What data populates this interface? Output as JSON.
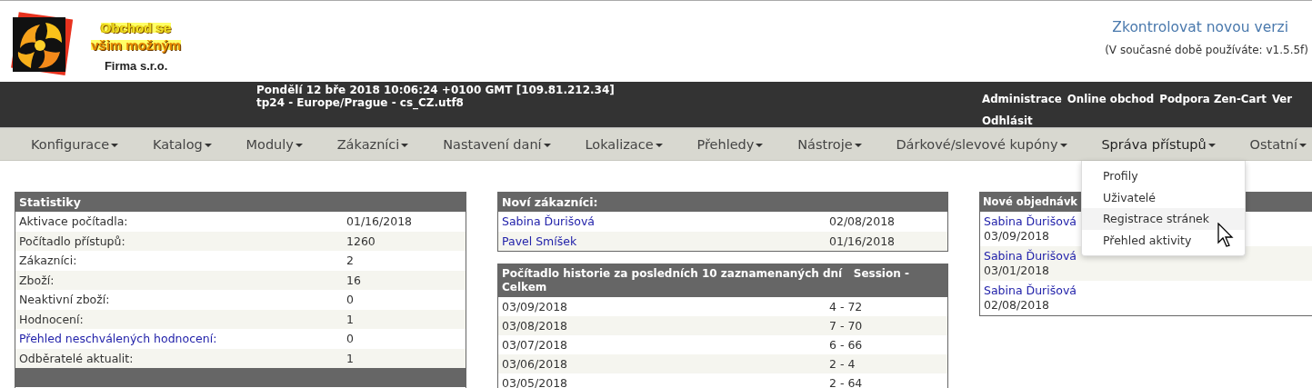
{
  "header": {
    "logo_lines": [
      "Obchod se",
      "všim možným"
    ],
    "company": "Firma s.r.o.",
    "update_link": "Zkontrolovat novou verzi",
    "version_note": "(V současné době používáte: v1.5.5f)"
  },
  "top_bar": {
    "info_lines": [
      "Pondělí 12 bře 2018 10:06:24 +0100 GMT [109.81.212.34]",
      "tp24 - Europe/Prague - cs_CZ.utf8"
    ],
    "links_row_1": [
      "Administrace",
      "Online obchod",
      "Podpora Zen-Cart",
      "Ver"
    ],
    "links_row_2": [
      "Odhlásit"
    ]
  },
  "nav": [
    {
      "label": "Konfigurace",
      "expanded": false
    },
    {
      "label": "Katalog",
      "expanded": false
    },
    {
      "label": "Moduly",
      "expanded": false
    },
    {
      "label": "Zákazníci",
      "expanded": false
    },
    {
      "label": "Nastavení daní",
      "expanded": false
    },
    {
      "label": "Lokalizace",
      "expanded": false
    },
    {
      "label": "Přehledy",
      "expanded": false
    },
    {
      "label": "Nástroje",
      "expanded": false
    },
    {
      "label": "Dárkové/slevové kupóny",
      "expanded": false
    },
    {
      "label": "Správa přístupů",
      "expanded": true
    },
    {
      "label": "Ostatní",
      "expanded": false
    }
  ],
  "dropdown": [
    {
      "label": "Profily",
      "highlighted": false
    },
    {
      "label": "Uživatelé",
      "highlighted": false
    },
    {
      "label": "Registrace stránek",
      "highlighted": true
    },
    {
      "label": "Přehled aktivity",
      "highlighted": false
    }
  ],
  "statistics": {
    "title": "Statistiky",
    "rows": [
      {
        "label": "Aktivace počítadla:",
        "value": "01/16/2018",
        "link": false
      },
      {
        "label": "Počítadlo přístupů:",
        "value": "1260",
        "link": false
      },
      {
        "label": "Zákazníci:",
        "value": "2",
        "link": false
      },
      {
        "label": "Zboží:",
        "value": "16",
        "link": false
      },
      {
        "label": "Neaktivní zboží:",
        "value": "0",
        "link": false
      },
      {
        "label": "Hodnocení:",
        "value": "1",
        "link": false
      },
      {
        "label": "Přehled neschválených hodnocení:",
        "value": "0",
        "link": true
      },
      {
        "label": "Odběratelé aktualit:",
        "value": "1",
        "link": false
      }
    ]
  },
  "new_customers": {
    "title": "Noví zákazníci:",
    "rows": [
      {
        "name": "Sabina Ďurišová",
        "date": "02/08/2018"
      },
      {
        "name": "Pavel Smíšek",
        "date": "01/16/2018"
      }
    ]
  },
  "history": {
    "title": "Počítadlo historie za posledních 10 zaznamenaných dní",
    "title_2": "Session - Celkem",
    "rows": [
      {
        "date": "03/09/2018",
        "value": "4 - 72"
      },
      {
        "date": "03/08/2018",
        "value": "7 - 70"
      },
      {
        "date": "03/07/2018",
        "value": "6 - 66"
      },
      {
        "date": "03/06/2018",
        "value": "2 - 4"
      },
      {
        "date": "03/05/2018",
        "value": "2 - 64"
      }
    ]
  },
  "new_orders": {
    "title": "Nové objednávk",
    "rows": [
      {
        "name": "Sabina Ďurišová",
        "date": "03/09/2018"
      },
      {
        "name": "Sabina Ďurišová",
        "date": "03/01/2018"
      },
      {
        "name": "Sabina Ďurišová",
        "date": "02/08/2018"
      }
    ]
  }
}
